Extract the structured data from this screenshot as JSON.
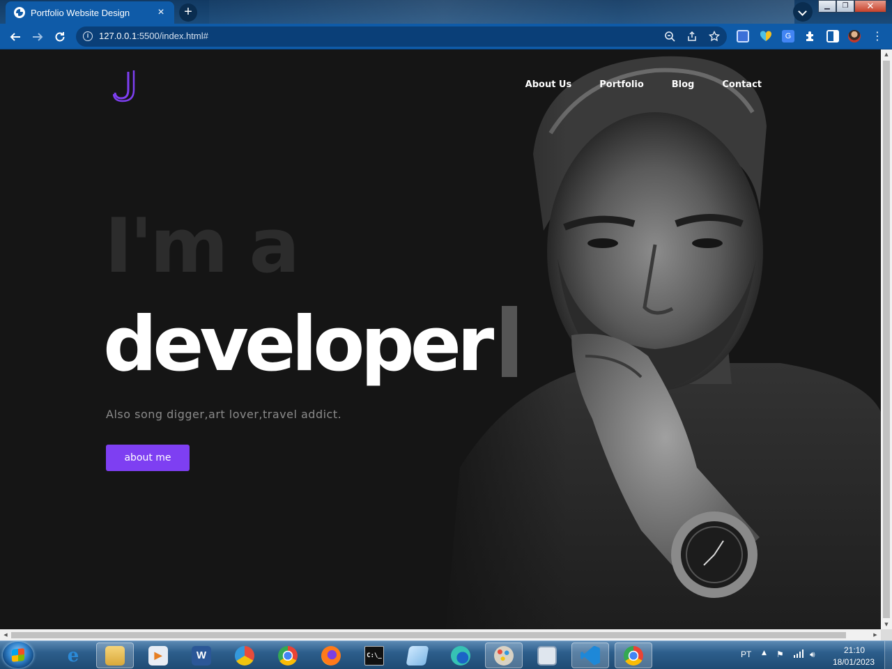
{
  "browser": {
    "tab_title": "Portfolio Website Design",
    "tab_close": "×",
    "new_tab": "+",
    "url_host": "127.0.0.1",
    "url_rest": ":5500/index.html#",
    "win_minimize": "▁",
    "win_maximize": "❐",
    "win_close": "✕"
  },
  "site": {
    "nav": [
      {
        "label": "About Us"
      },
      {
        "label": "Portfolio"
      },
      {
        "label": "Blog"
      },
      {
        "label": "Contact"
      }
    ],
    "hero_line1": "I'm a",
    "hero_line2": "developer",
    "tagline": "Also song digger,art lover,travel addict.",
    "cta_label": "about me",
    "accent_color": "#7e3ff2"
  },
  "taskbar": {
    "apps": [
      {
        "name": "internet-explorer-icon"
      },
      {
        "name": "file-explorer-icon"
      },
      {
        "name": "media-player-icon"
      },
      {
        "name": "word-icon"
      },
      {
        "name": "vpn-icon"
      },
      {
        "name": "chrome-icon"
      },
      {
        "name": "firefox-icon"
      },
      {
        "name": "command-prompt-icon"
      },
      {
        "name": "notepad-icon"
      },
      {
        "name": "edge-icon"
      },
      {
        "name": "paint-icon"
      },
      {
        "name": "remote-desktop-icon"
      },
      {
        "name": "vscode-icon"
      },
      {
        "name": "chrome-active-icon"
      }
    ],
    "language": "PT",
    "time": "21:10",
    "date": "18/01/2023"
  }
}
